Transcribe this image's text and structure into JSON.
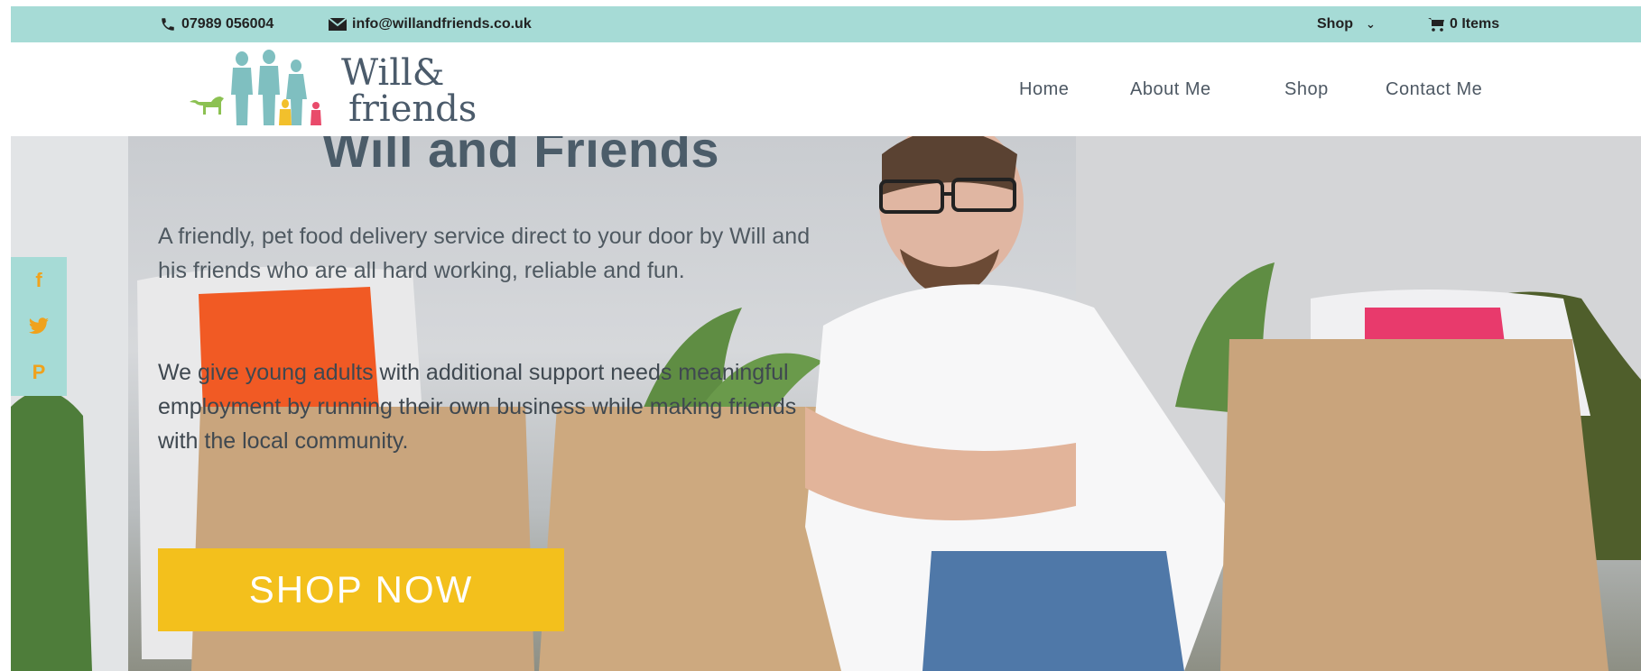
{
  "topbar": {
    "phone": "07989 056004",
    "email": "info@willandfriends.co.uk",
    "shop_label": "Shop",
    "cart_label": "0 Items"
  },
  "logo": {
    "line1": "Will&",
    "line2": "friends"
  },
  "nav": {
    "items": [
      {
        "label": "Home"
      },
      {
        "label": "About Me"
      },
      {
        "label": "Shop"
      },
      {
        "label": "Contact Me"
      }
    ]
  },
  "hero": {
    "title": "Will and Friends",
    "paragraph1": "A friendly, pet food delivery service direct to your door by Will and his friends who are all hard working, reliable and fun.",
    "paragraph2": "We give young adults with additional support needs meaningful employment by running their own business while making friends with the local community.",
    "cta_label": "SHOP NOW"
  },
  "social": {
    "facebook_glyph": "f",
    "pinterest_glyph": "P"
  },
  "colors": {
    "topbar": "#a6dbd6",
    "cta": "#f3c01c",
    "social_icon": "#f0a21c",
    "heading": "#4b5c69"
  }
}
